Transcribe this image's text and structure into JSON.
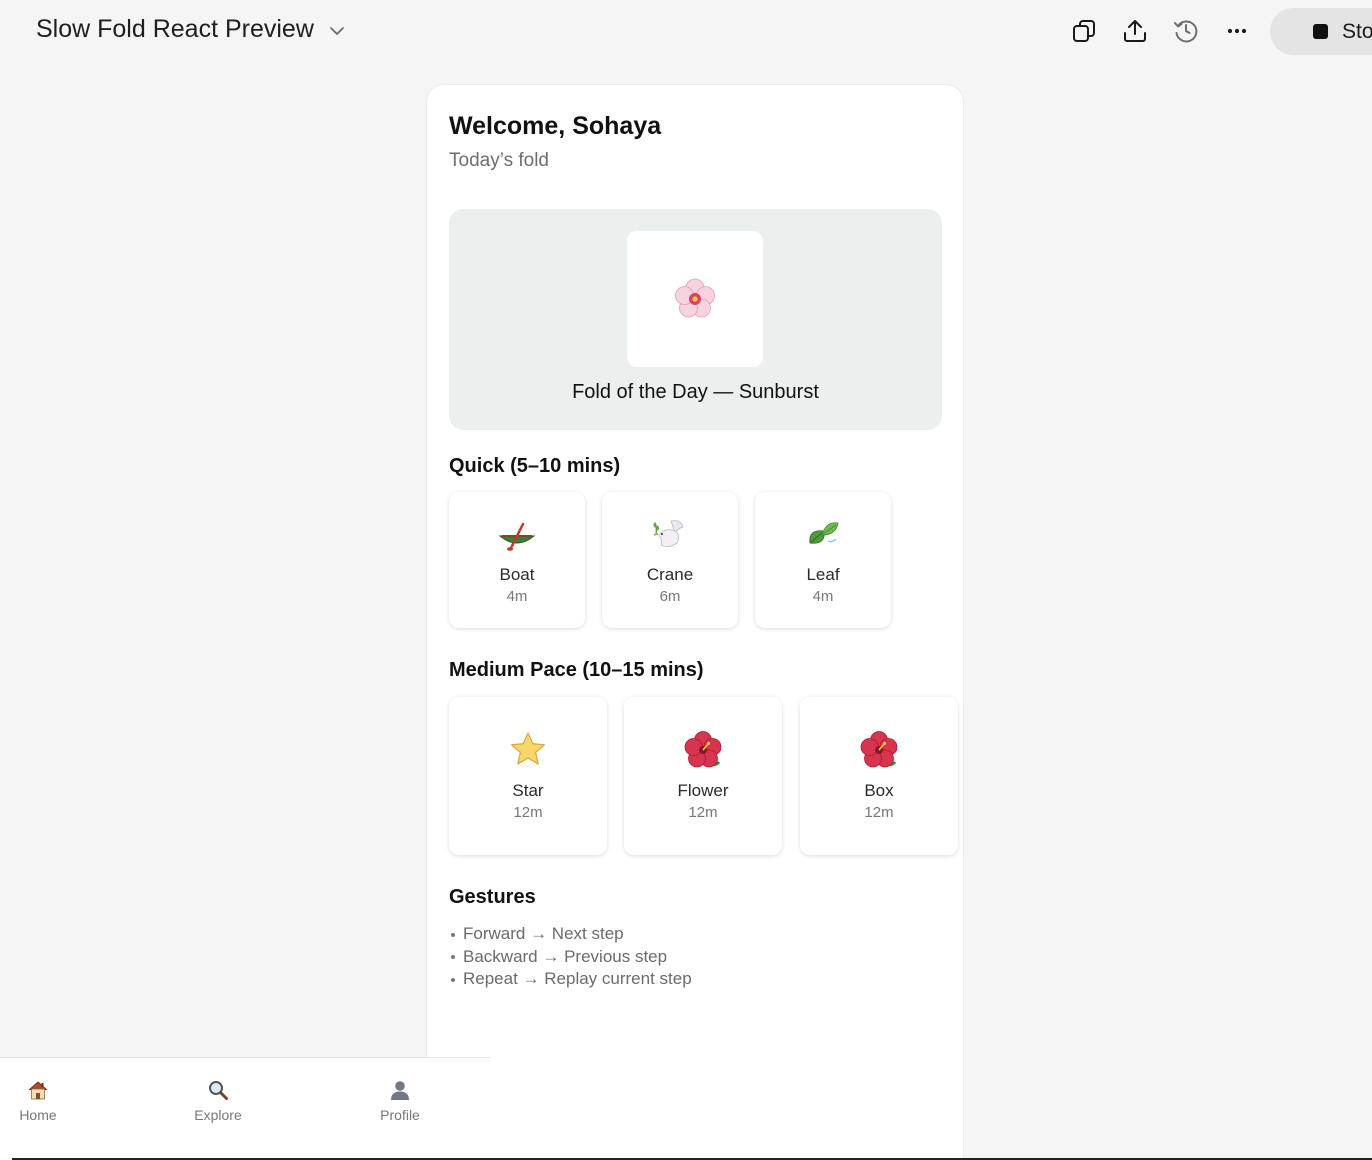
{
  "header": {
    "title": "Slow Fold React Preview",
    "stop_label": "Stop"
  },
  "icons": {
    "title_dropdown": "chevron-down-icon",
    "toolbar": [
      "copy-icon",
      "upload-icon",
      "history-icon",
      "more-icon"
    ],
    "stop": "stop-square-icon"
  },
  "app": {
    "welcome": "Welcome, Sohaya",
    "subtitle": "Today’s fold",
    "hero": {
      "icon": "cherry-blossom-icon",
      "caption": "Fold of the Day — Sunburst"
    },
    "quick": {
      "title": "Quick (5–10 mins)",
      "items": [
        {
          "name": "Boat",
          "duration": "4m",
          "icon": "canoe-icon"
        },
        {
          "name": "Crane",
          "duration": "6m",
          "icon": "dove-icon"
        },
        {
          "name": "Leaf",
          "duration": "4m",
          "icon": "leaf-icon"
        }
      ]
    },
    "medium": {
      "title": "Medium Pace (10–15 mins)",
      "items": [
        {
          "name": "Star",
          "duration": "12m",
          "icon": "star-icon"
        },
        {
          "name": "Flower",
          "duration": "12m",
          "icon": "hibiscus-icon"
        },
        {
          "name": "Box",
          "duration": "12m",
          "icon": "hibiscus-icon"
        }
      ]
    },
    "gestures": {
      "title": "Gestures",
      "items": [
        "Forward → Next step",
        "Backward → Previous step",
        "Repeat → Replay current step"
      ]
    }
  },
  "nav": {
    "items": [
      {
        "label": "Home",
        "icon": "house-icon"
      },
      {
        "label": "Explore",
        "icon": "magnifier-icon"
      },
      {
        "label": "Profile",
        "icon": "person-icon"
      }
    ]
  },
  "colors": {
    "hero_bg": "#ebf0ee",
    "page_bg": "#f5f5f5",
    "card_bg": "#ffffff"
  }
}
